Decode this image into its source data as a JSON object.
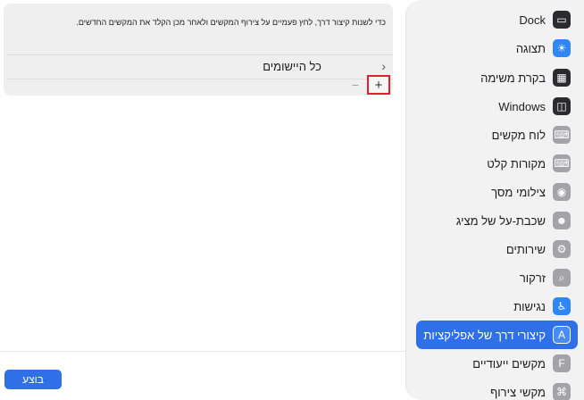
{
  "sidebar": {
    "items": [
      {
        "label": "Dock",
        "icon": "dock-icon",
        "glyph": "▭",
        "style": "ic-dark"
      },
      {
        "label": "תצוגה",
        "icon": "display-brightness-icon",
        "glyph": "☀",
        "style": "ic-blue"
      },
      {
        "label": "בקרת משימה",
        "icon": "mission-control-icon",
        "glyph": "▦",
        "style": "ic-dark"
      },
      {
        "label": "Windows",
        "icon": "windows-icon",
        "glyph": "◫",
        "style": "ic-dark"
      },
      {
        "label": "לוח מקשים",
        "icon": "keyboard-icon",
        "glyph": "⌨",
        "style": "ic-gray"
      },
      {
        "label": "מקורות קלט",
        "icon": "input-sources-icon",
        "glyph": "⌨",
        "style": "ic-gray"
      },
      {
        "label": "צילומי מסך",
        "icon": "screenshot-camera-icon",
        "glyph": "◉",
        "style": "ic-gray"
      },
      {
        "label": "שכבת-על של מציג",
        "icon": "presenter-overlay-icon",
        "glyph": "☻",
        "style": "ic-gray"
      },
      {
        "label": "שירותים",
        "icon": "services-gear-icon",
        "glyph": "⚙",
        "style": "ic-gray"
      },
      {
        "label": "זרקור",
        "icon": "spotlight-search-icon",
        "glyph": "⌕",
        "style": "ic-gray"
      },
      {
        "label": "נגישות",
        "icon": "accessibility-icon",
        "glyph": "♿",
        "style": "ic-blue"
      },
      {
        "label": "קיצורי דרך של אפליקציות",
        "icon": "app-store-icon",
        "glyph": "A",
        "style": "ic-appstore",
        "active": true
      },
      {
        "label": "מקשים ייעודיים",
        "icon": "function-keys-icon",
        "glyph": "F",
        "style": "ic-gray"
      },
      {
        "label": "מקשי צירוף",
        "icon": "command-key-icon",
        "glyph": "⌘",
        "style": "ic-gray"
      }
    ]
  },
  "main": {
    "description": "כדי לשנות קיצור דרך, לחץ פעמיים על צירוף המקשים ולאחר מכן הקלד את המקשים החדשים.",
    "all_apps_label": "כל היישומים",
    "chevron": "›",
    "plus": "+",
    "minus": "−"
  },
  "footer": {
    "done_label": "בוצע"
  },
  "colors": {
    "accent": "#2f6fe8",
    "highlight_border": "#e0202a",
    "sidebar_bg": "#f2f2f2",
    "panel_bg": "#efefef"
  }
}
